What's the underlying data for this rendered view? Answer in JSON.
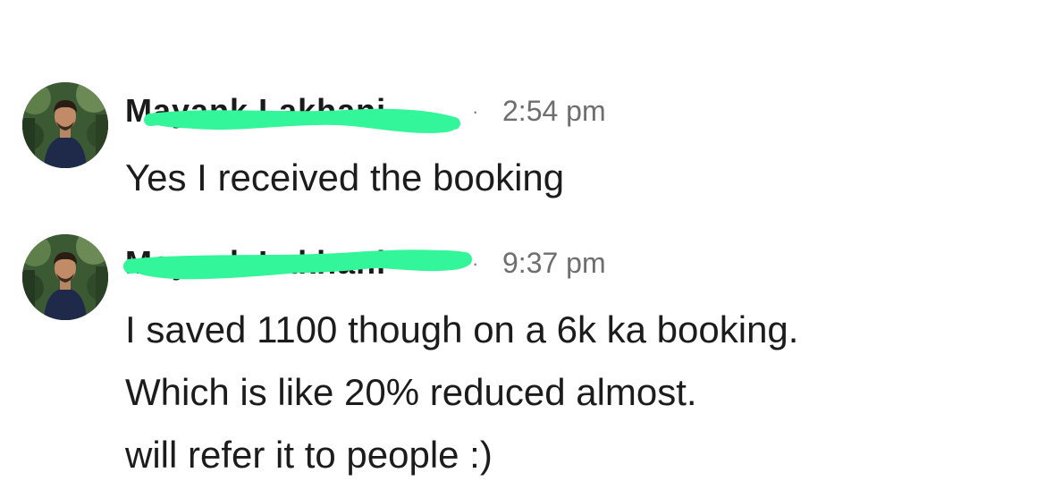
{
  "conversation": {
    "messages": [
      {
        "sender": "Mayank Lakhani",
        "separator": "·",
        "time": "2:54 pm",
        "lines": [
          "Yes I received the booking"
        ]
      },
      {
        "sender": "Mayank Lakhani",
        "separator": "·",
        "time": "9:37 pm",
        "lines": [
          "I saved 1100 though on a 6k ka booking.",
          "Which is like 20% reduced almost.",
          "will refer it to people :)"
        ]
      }
    ]
  },
  "colors": {
    "redaction": "#33f59a",
    "timestamp": "#6e6e6e",
    "text": "#1c1c1c"
  },
  "icons": {
    "avatar": "user-photo-avatar"
  }
}
